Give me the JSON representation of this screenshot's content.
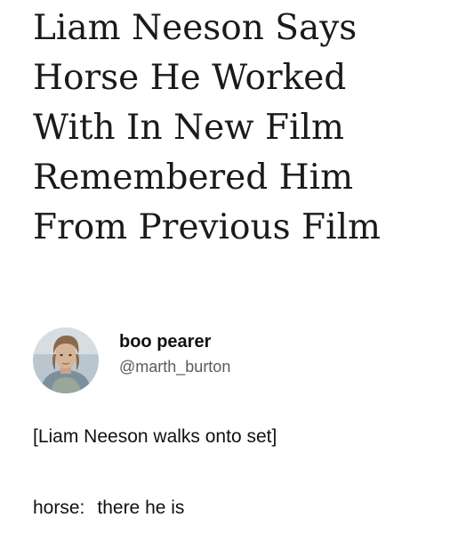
{
  "headline": {
    "lines": [
      "Liam Neeson Says",
      "Horse He Worked",
      "With In New Film",
      "Remembered Him",
      "From Previous Film"
    ]
  },
  "tweet": {
    "display_name": "boo pearer",
    "handle": "@marth_burton",
    "avatar": "person-photo-avatar",
    "line1": "[Liam Neeson walks onto set]",
    "line2_speaker": "horse:",
    "line2_text": "there he is"
  }
}
